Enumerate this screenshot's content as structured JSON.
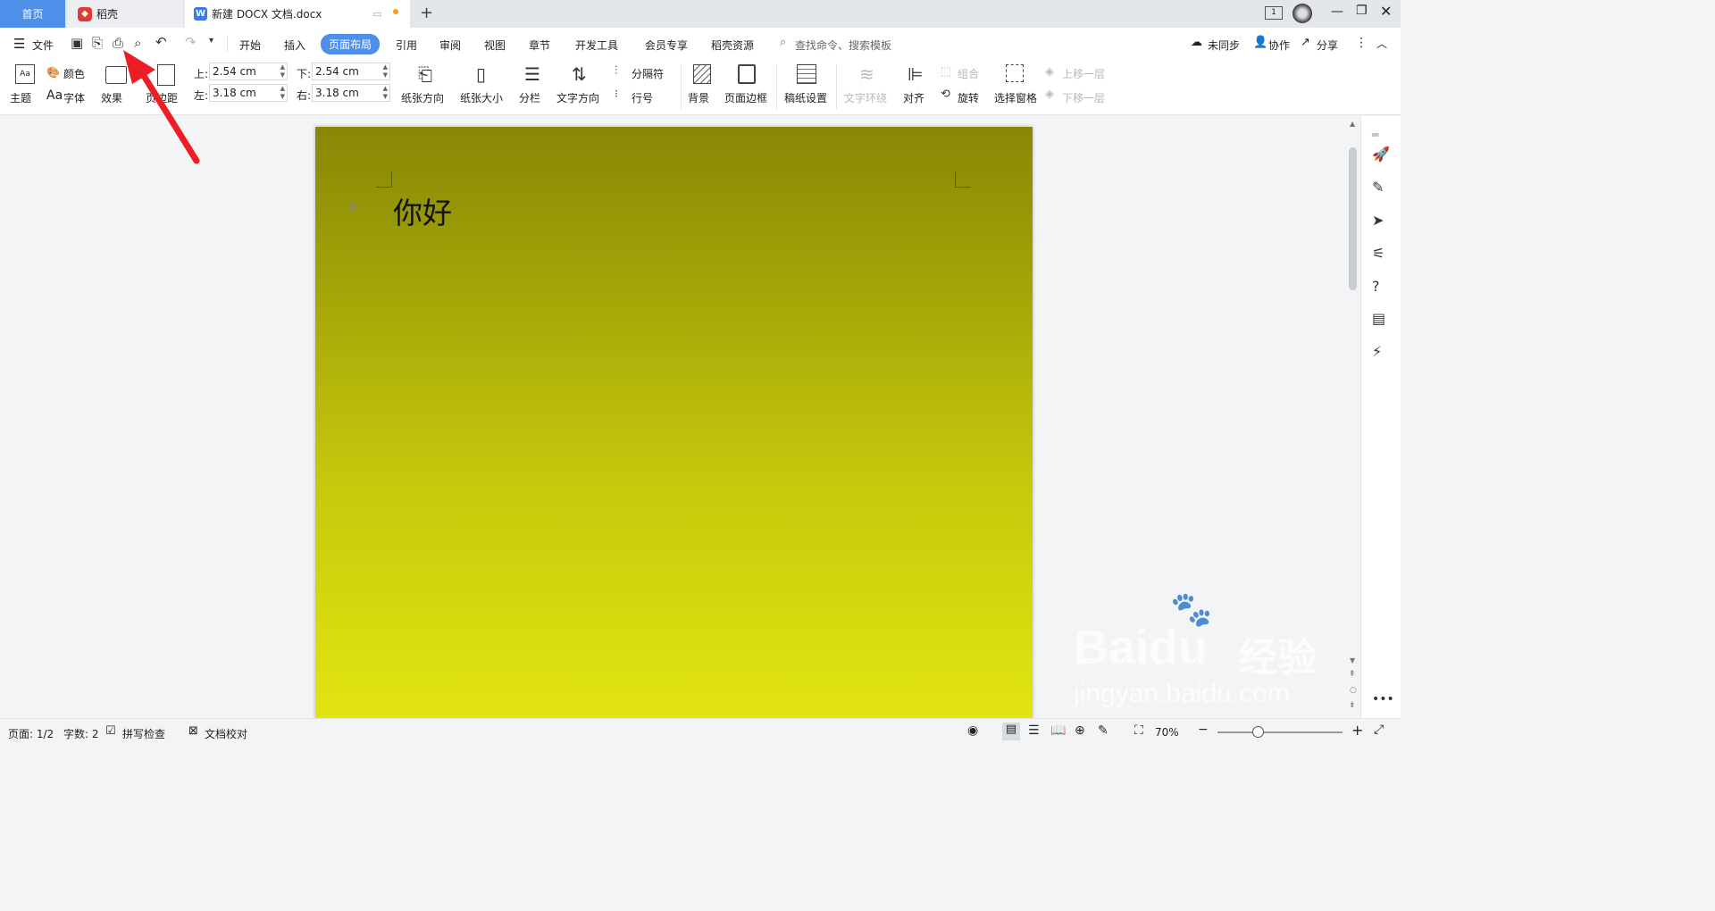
{
  "tabs": {
    "home": "首页",
    "daoke": "稻壳",
    "doc": "新建 DOCX 文档.docx",
    "new_tab": "+"
  },
  "window": {
    "page_count_badge": "1"
  },
  "quick": {
    "file": "文件"
  },
  "menu": [
    "开始",
    "插入",
    "页面布局",
    "引用",
    "审阅",
    "视图",
    "章节",
    "开发工具",
    "会员专享",
    "稻壳资源"
  ],
  "search": {
    "placeholder": "查找命令、搜索模板"
  },
  "right_actions": {
    "sync": "未同步",
    "collab": "协作",
    "share": "分享"
  },
  "ribbon": {
    "theme": "主题",
    "colors": "颜色",
    "fonts": "字体",
    "effects": "效果",
    "margins": "页边距",
    "margin_top_label": "上:",
    "margin_top": "2.54 cm",
    "margin_bottom_label": "下:",
    "margin_bottom": "2.54 cm",
    "margin_left_label": "左:",
    "margin_left": "3.18 cm",
    "margin_right_label": "右:",
    "margin_right": "3.18 cm",
    "orientation": "纸张方向",
    "size": "纸张大小",
    "columns": "分栏",
    "text_direction": "文字方向",
    "breaks": "分隔符",
    "line_numbers": "行号",
    "background": "背景",
    "page_border": "页面边框",
    "grid_paper": "稿纸设置",
    "wrap_text": "文字环绕",
    "align": "对齐",
    "group": "组合",
    "rotate": "旋转",
    "selection_pane": "选择窗格",
    "bring_forward": "上移一层",
    "send_backward": "下移一层"
  },
  "document": {
    "text": "你好"
  },
  "status": {
    "page": "页面: 1/2",
    "words": "字数: 2",
    "spell": "拼写检查",
    "proof": "文档校对",
    "zoom": "70%"
  },
  "colors": {
    "accent": "#4e8fe9",
    "page_top": "#878705",
    "page_bottom": "#e2e510",
    "arrow": "#ee1c25"
  },
  "watermark": {
    "brand": "Baidu",
    "brand_cn": "经验",
    "url": "jingyan.baidu.com"
  }
}
